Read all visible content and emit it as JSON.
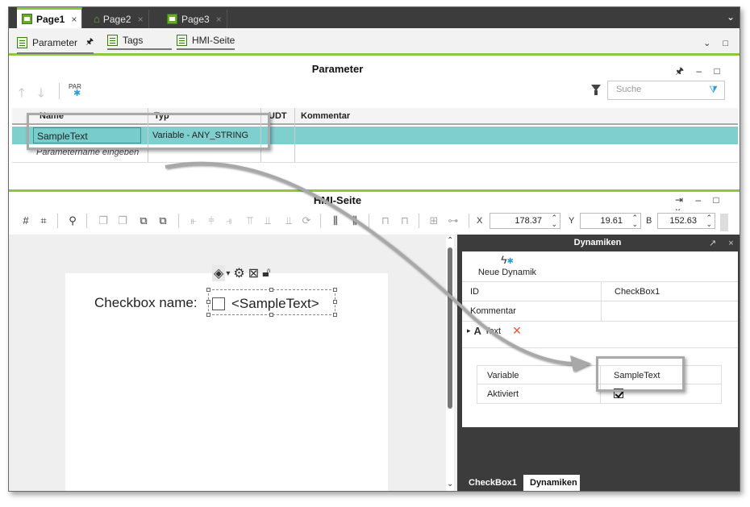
{
  "tabs": [
    {
      "label": "Page1",
      "active": true,
      "close": "×"
    },
    {
      "label": "Page2",
      "active": false,
      "close": "×"
    },
    {
      "label": "Page3",
      "active": false,
      "close": "×"
    }
  ],
  "subtabs": [
    {
      "label": "Parameter",
      "pin": "🖈"
    },
    {
      "label": "Tags"
    },
    {
      "label": "HMI-Seite"
    }
  ],
  "parameter_panel": {
    "title": "Parameter",
    "toolbar_par": "PAR",
    "search_placeholder": "Suche",
    "columns": [
      "Name",
      "Typ",
      "UDT",
      "Kommentar"
    ],
    "rows": [
      {
        "name": "SampleText",
        "type": "Variable - ANY_STRING",
        "udt": "",
        "comment": ""
      }
    ],
    "new_row_hint": "Parametername eingeben"
  },
  "hmi_panel": {
    "title": "HMI-Seite",
    "x_label": "X",
    "x_value": "178.37",
    "y_label": "Y",
    "y_value": "19.61",
    "b_label": "B",
    "b_value": "152.63",
    "checkbox_label": "Checkbox name:",
    "checkbox_text": "<SampleText>"
  },
  "dynamics_panel": {
    "title": "Dynamiken",
    "new_dynamic_label": "Neue Dynamik",
    "properties": [
      {
        "key": "ID",
        "value": "CheckBox1"
      },
      {
        "key": "Kommentar",
        "value": ""
      }
    ],
    "text_section_label": "Text",
    "text_section_remove": "✕",
    "inner_properties": [
      {
        "key": "Variable",
        "value": "SampleText"
      },
      {
        "key": "Aktiviert",
        "value": "",
        "checked": true
      }
    ],
    "bottom_tabs": [
      {
        "label": "CheckBox1",
        "active": false
      },
      {
        "label": "Dynamiken",
        "active": true
      }
    ]
  },
  "colors": {
    "accent_green": "#8dc63f",
    "selected_row": "#7fcfcf",
    "dark_bar": "#3c3c3c",
    "remove_red": "#e8543b"
  }
}
